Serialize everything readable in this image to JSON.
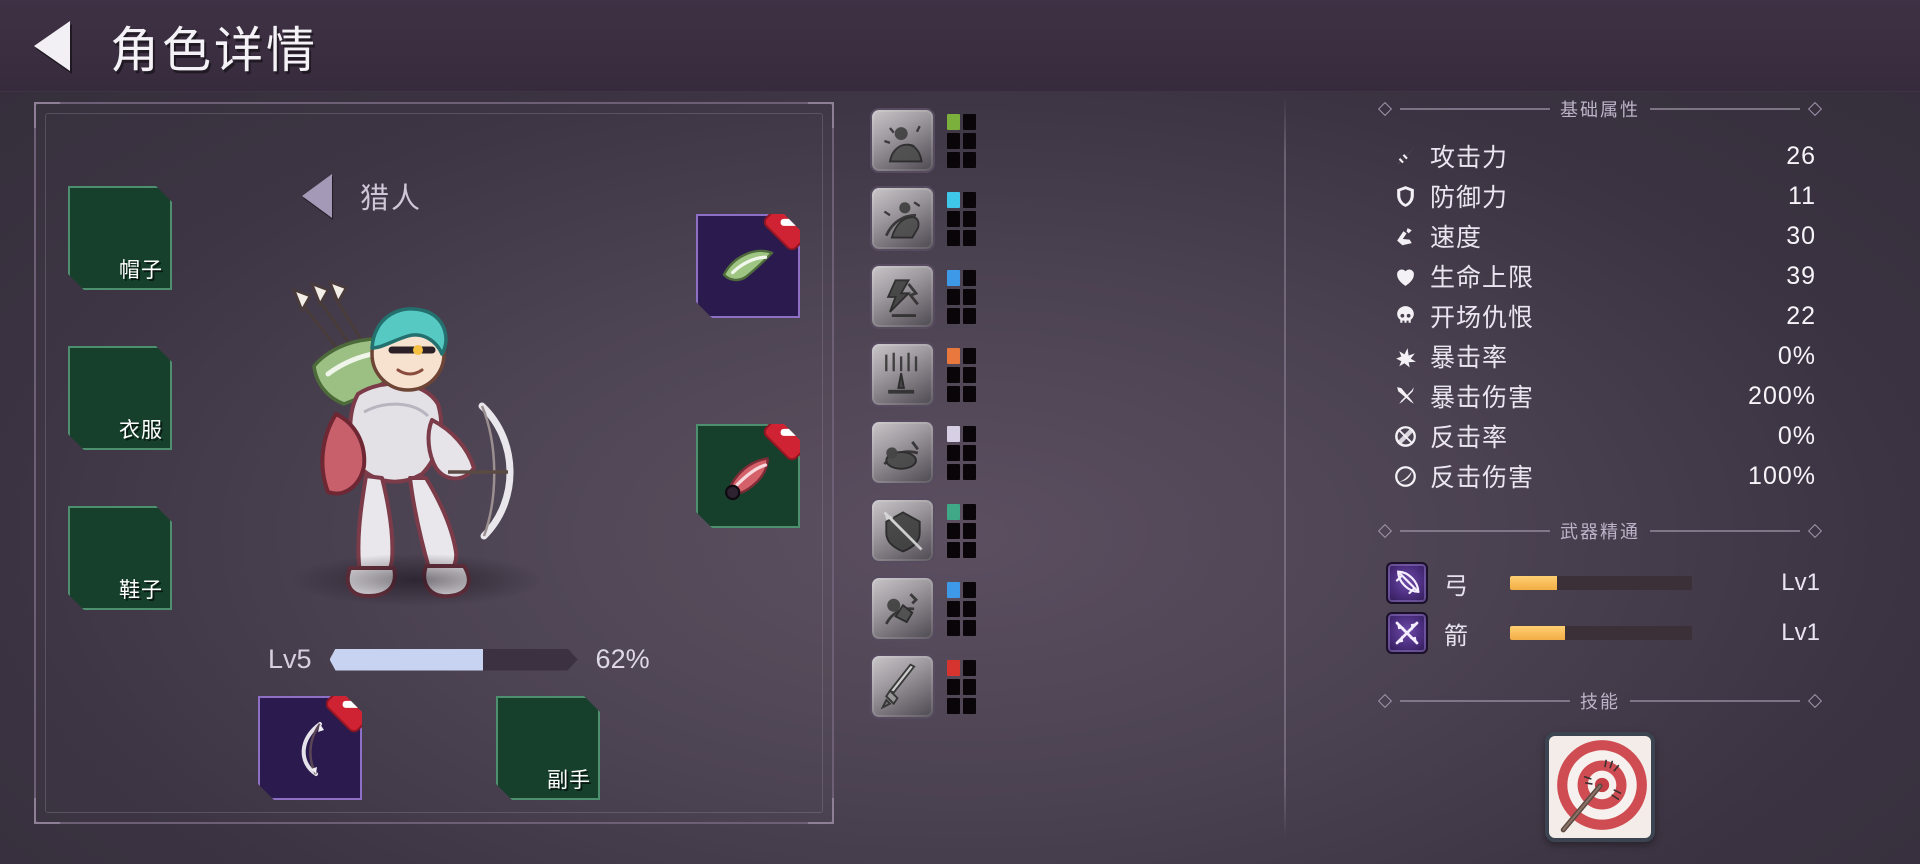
{
  "header": {
    "title": "角色详情",
    "back_icon": "back-arrow-icon"
  },
  "character": {
    "class_name": "猎人",
    "prev_icon": "left-arrow-icon",
    "level_label": "Lv5",
    "xp_percent_label": "62%",
    "xp_percent": 62,
    "sprite_name": "hunter-archer-sprite"
  },
  "equipment": {
    "slots": [
      {
        "id": "hat",
        "label": "帽子",
        "state": "empty",
        "has_remove": false
      },
      {
        "id": "clothes",
        "label": "衣服",
        "state": "empty",
        "has_remove": false
      },
      {
        "id": "shoes",
        "label": "鞋子",
        "state": "empty",
        "has_remove": false
      },
      {
        "id": "accessory-1",
        "label": "",
        "state": "filled-purple",
        "has_remove": true,
        "item_icon": "green-scarf-item"
      },
      {
        "id": "accessory-2",
        "label": "",
        "state": "filled-green",
        "has_remove": true,
        "item_icon": "red-glove-item"
      },
      {
        "id": "weapon",
        "label": "",
        "state": "filled-purple",
        "has_remove": true,
        "item_icon": "bow-item"
      },
      {
        "id": "offhand",
        "label": "副手",
        "state": "empty",
        "has_remove": false
      }
    ]
  },
  "cards": [
    {
      "name": "card-cheer",
      "pip_color": "#7bb03c"
    },
    {
      "name": "card-rider",
      "pip_color": "#3ec7e8"
    },
    {
      "name": "card-lightning",
      "pip_color": "#3e9ae8"
    },
    {
      "name": "card-rain-sword",
      "pip_color": "#e8783e"
    },
    {
      "name": "card-fallen",
      "pip_color": "#d7cfe4"
    },
    {
      "name": "card-bow-shield",
      "pip_color": "#3ea887"
    },
    {
      "name": "card-knight",
      "pip_color": "#3e9ae8"
    },
    {
      "name": "card-sword",
      "pip_color": "#d6352f"
    }
  ],
  "stats_section": {
    "title": "基础属性",
    "rows": [
      {
        "icon": "sword-icon",
        "label": "攻击力",
        "value": "26"
      },
      {
        "icon": "shield-icon",
        "label": "防御力",
        "value": "11"
      },
      {
        "icon": "boot-icon",
        "label": "速度",
        "value": "30"
      },
      {
        "icon": "heart-icon",
        "label": "生命上限",
        "value": "39"
      },
      {
        "icon": "skull-icon",
        "label": "开场仇恨",
        "value": "22"
      },
      {
        "icon": "burst-icon",
        "label": "暴击率",
        "value": "0%"
      },
      {
        "icon": "crossed-swords-icon",
        "label": "暴击伤害",
        "value": "200%"
      },
      {
        "icon": "counter-slash-icon",
        "label": "反击率",
        "value": "0%"
      },
      {
        "icon": "counter-orbit-icon",
        "label": "反击伤害",
        "value": "100%"
      }
    ]
  },
  "mastery_section": {
    "title": "武器精通",
    "rows": [
      {
        "icon": "bow-mastery-icon",
        "name": "弓",
        "level": "Lv1",
        "progress": 26
      },
      {
        "icon": "arrow-mastery-icon",
        "name": "箭",
        "level": "Lv1",
        "progress": 30
      }
    ]
  },
  "skill_section": {
    "title": "技能",
    "skills": [
      {
        "name": "bullseye-target-skill"
      }
    ]
  }
}
